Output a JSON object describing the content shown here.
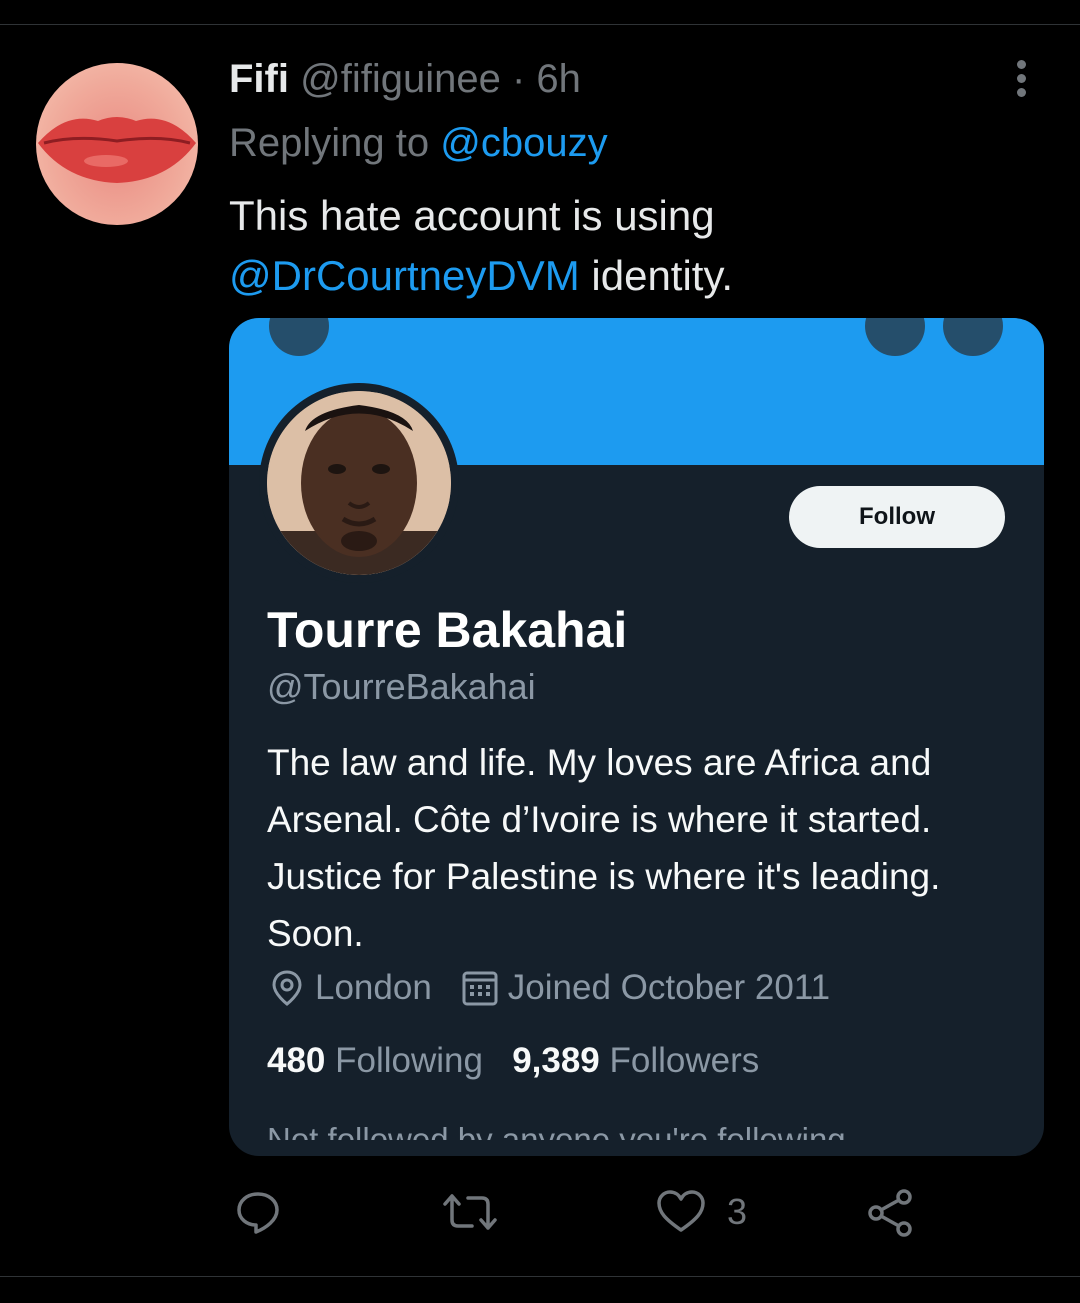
{
  "tweet": {
    "author_name": "Fifi",
    "author_handle": "@fifiguinee",
    "separator": "·",
    "time": "6h",
    "replying_prefix": "Replying to",
    "replying_to": "@cbouzy",
    "text_part1": "This hate account is using",
    "text_mention": "@DrCourtneyDVM",
    "text_part2": "identity."
  },
  "card": {
    "follow_label": "Follow",
    "name": "Tourre Bakahai",
    "handle": "@TourreBakahai",
    "bio": "The law and life. My loves are Africa and Arsenal. Côte d’Ivoire is where it started. Justice for Palestine is where it's leading. Soon.",
    "location": "London",
    "joined": "Joined October 2011",
    "following_count": "480",
    "following_label": "Following",
    "followers_count": "9,389",
    "followers_label": "Followers",
    "cut_text": "Not followed by anyone you're following"
  },
  "actions": {
    "like_count": "3"
  },
  "icons": [
    "more-icon",
    "reply-icon",
    "retweet-icon",
    "like-icon",
    "share-icon",
    "location-icon",
    "calendar-icon",
    "back-icon",
    "search-icon"
  ],
  "colors": {
    "background": "#000000",
    "accent": "#1d9bf0",
    "muted": "#71767b",
    "card_bg": "#15202b"
  }
}
